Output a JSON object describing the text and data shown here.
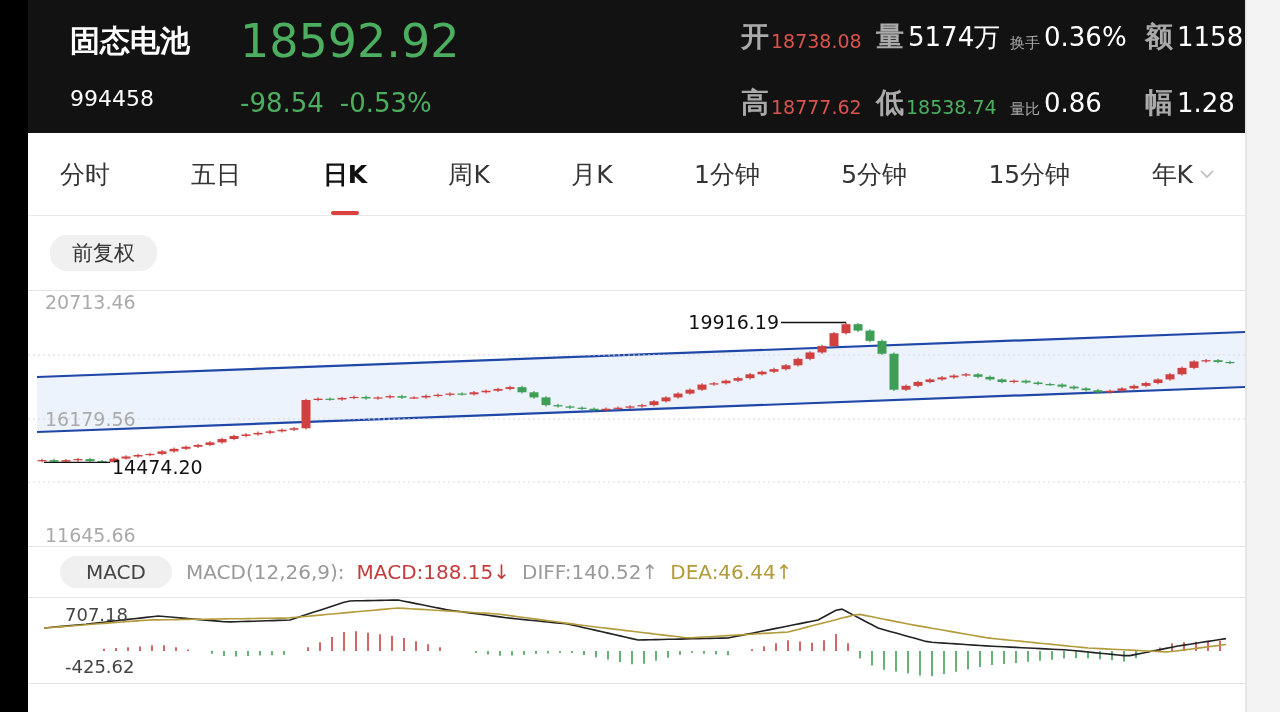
{
  "header": {
    "name": "固态电池",
    "code": "994458",
    "price": "18592.92",
    "change": "-98.54",
    "change_pct": "-0.53%",
    "stats": [
      {
        "label": "开",
        "value": "18738.08",
        "color": "#d9534f",
        "kind": "large"
      },
      {
        "label": "量",
        "value": "5174万",
        "color": "#ffffff",
        "kind": "large"
      },
      {
        "label": "换手",
        "value": "0.36%",
        "color": "#ffffff",
        "kind": "small"
      },
      {
        "label": "额",
        "value": "1158",
        "color": "#ffffff",
        "kind": "large"
      },
      {
        "label": "高",
        "value": "18777.62",
        "color": "#d9534f",
        "kind": "large"
      },
      {
        "label": "低",
        "value": "18538.74",
        "color": "#4caf5f",
        "kind": "large"
      },
      {
        "label": "量比",
        "value": "0.86",
        "color": "#ffffff",
        "kind": "small"
      },
      {
        "label": "幅",
        "value": "1.28",
        "color": "#ffffff",
        "kind": "large"
      }
    ]
  },
  "tabs": [
    {
      "label": "分时",
      "selected": false,
      "dropdown": false
    },
    {
      "label": "五日",
      "selected": false,
      "dropdown": false
    },
    {
      "label": "日K",
      "selected": true,
      "dropdown": false
    },
    {
      "label": "周K",
      "selected": false,
      "dropdown": false
    },
    {
      "label": "月K",
      "selected": false,
      "dropdown": false
    },
    {
      "label": "1分钟",
      "selected": false,
      "dropdown": false
    },
    {
      "label": "5分钟",
      "selected": false,
      "dropdown": false
    },
    {
      "label": "15分钟",
      "selected": false,
      "dropdown": false
    },
    {
      "label": "年K",
      "selected": false,
      "dropdown": true
    }
  ],
  "adjust_button": "前复权",
  "price_chart": {
    "chart_data": {
      "type": "candlestick",
      "ylim": [
        11645.66,
        20713.46
      ],
      "yticks": [
        20713.46,
        16179.56,
        11645.66
      ],
      "annotations": [
        "19916.19",
        "14474.20"
      ],
      "ohlc": [
        [
          14520,
          14610,
          14474.2,
          14560
        ],
        [
          14560,
          14610,
          14480,
          14500
        ],
        [
          14500,
          14600,
          14480,
          14560
        ],
        [
          14560,
          14640,
          14500,
          14600
        ],
        [
          14600,
          14640,
          14480,
          14520
        ],
        [
          14520,
          14560,
          14478,
          14480
        ],
        [
          14480,
          14670,
          14480,
          14620
        ],
        [
          14620,
          14750,
          14570,
          14700
        ],
        [
          14700,
          14810,
          14650,
          14760
        ],
        [
          14760,
          14850,
          14710,
          14800
        ],
        [
          14800,
          14950,
          14750,
          14900
        ],
        [
          14900,
          15050,
          14850,
          15000
        ],
        [
          15000,
          15130,
          14950,
          15080
        ],
        [
          15080,
          15200,
          15030,
          15150
        ],
        [
          15150,
          15300,
          15100,
          15250
        ],
        [
          15250,
          15430,
          15200,
          15380
        ],
        [
          15380,
          15550,
          15330,
          15500
        ],
        [
          15500,
          15610,
          15450,
          15560
        ],
        [
          15560,
          15670,
          15510,
          15620
        ],
        [
          15620,
          15730,
          15570,
          15680
        ],
        [
          15680,
          15790,
          15630,
          15740
        ],
        [
          15740,
          15850,
          15690,
          15800
        ],
        [
          15800,
          16950,
          15750,
          16900
        ],
        [
          16900,
          17000,
          16850,
          16950
        ],
        [
          16950,
          17000,
          16870,
          16920
        ],
        [
          16920,
          17030,
          16870,
          16980
        ],
        [
          16980,
          17070,
          16930,
          17020
        ],
        [
          17020,
          17070,
          16910,
          16960
        ],
        [
          16960,
          17050,
          16910,
          17000
        ],
        [
          17000,
          17100,
          16950,
          17050
        ],
        [
          17050,
          17100,
          16940,
          16990
        ],
        [
          16990,
          17050,
          16940,
          17000
        ],
        [
          17000,
          17110,
          16950,
          17060
        ],
        [
          17060,
          17150,
          17010,
          17100
        ],
        [
          17100,
          17200,
          17050,
          17150
        ],
        [
          17150,
          17200,
          17070,
          17120
        ],
        [
          17120,
          17250,
          17070,
          17200
        ],
        [
          17200,
          17310,
          17150,
          17260
        ],
        [
          17260,
          17380,
          17210,
          17330
        ],
        [
          17330,
          17450,
          17280,
          17400
        ],
        [
          17400,
          17450,
          17150,
          17200
        ],
        [
          17200,
          17250,
          16950,
          17000
        ],
        [
          17000,
          17050,
          16650,
          16700
        ],
        [
          16700,
          16750,
          16600,
          16650
        ],
        [
          16650,
          16700,
          16550,
          16600
        ],
        [
          16600,
          16650,
          16510,
          16560
        ],
        [
          16560,
          16610,
          16450,
          16500
        ],
        [
          16500,
          16610,
          16450,
          16560
        ],
        [
          16560,
          16650,
          16510,
          16600
        ],
        [
          16600,
          16700,
          16550,
          16650
        ],
        [
          16650,
          16750,
          16600,
          16700
        ],
        [
          16700,
          16900,
          16650,
          16850
        ],
        [
          16850,
          17050,
          16800,
          17000
        ],
        [
          17000,
          17200,
          16950,
          17150
        ],
        [
          17150,
          17350,
          17100,
          17300
        ],
        [
          17300,
          17550,
          17250,
          17500
        ],
        [
          17500,
          17600,
          17450,
          17550
        ],
        [
          17550,
          17700,
          17500,
          17650
        ],
        [
          17650,
          17800,
          17600,
          17750
        ],
        [
          17750,
          17950,
          17700,
          17900
        ],
        [
          17900,
          18050,
          17850,
          18000
        ],
        [
          18000,
          18150,
          17950,
          18100
        ],
        [
          18100,
          18300,
          18050,
          18250
        ],
        [
          18250,
          18550,
          18200,
          18500
        ],
        [
          18500,
          18800,
          18450,
          18750
        ],
        [
          18750,
          19050,
          18700,
          19000
        ],
        [
          19000,
          19550,
          18950,
          19500
        ],
        [
          19500,
          19916.19,
          19450,
          19850
        ],
        [
          19850,
          19900,
          19550,
          19600
        ],
        [
          19600,
          19650,
          19150,
          19200
        ],
        [
          19200,
          19250,
          18650,
          18700
        ],
        [
          18700,
          18750,
          17250,
          17300
        ],
        [
          17300,
          17500,
          17250,
          17450
        ],
        [
          17450,
          17650,
          17400,
          17600
        ],
        [
          17600,
          17750,
          17550,
          17700
        ],
        [
          17700,
          17830,
          17650,
          17780
        ],
        [
          17780,
          17900,
          17730,
          17850
        ],
        [
          17850,
          17950,
          17800,
          17900
        ],
        [
          17900,
          17950,
          17750,
          17800
        ],
        [
          17800,
          17850,
          17650,
          17700
        ],
        [
          17700,
          17750,
          17550,
          17600
        ],
        [
          17600,
          17700,
          17550,
          17650
        ],
        [
          17650,
          17700,
          17530,
          17580
        ],
        [
          17580,
          17630,
          17470,
          17520
        ],
        [
          17520,
          17570,
          17450,
          17500
        ],
        [
          17500,
          17550,
          17370,
          17420
        ],
        [
          17420,
          17470,
          17300,
          17350
        ],
        [
          17350,
          17400,
          17230,
          17280
        ],
        [
          17280,
          17330,
          17150,
          17200
        ],
        [
          17200,
          17310,
          17150,
          17260
        ],
        [
          17260,
          17400,
          17210,
          17350
        ],
        [
          17350,
          17500,
          17300,
          17450
        ],
        [
          17450,
          17610,
          17400,
          17560
        ],
        [
          17560,
          17750,
          17510,
          17700
        ],
        [
          17700,
          17950,
          17650,
          17900
        ],
        [
          17900,
          18200,
          17850,
          18150
        ],
        [
          18150,
          18450,
          18100,
          18400
        ],
        [
          18400,
          18500,
          18350,
          18450
        ],
        [
          18450,
          18500,
          18330,
          18380
        ],
        [
          18380,
          18430,
          18300,
          18350
        ]
      ]
    }
  },
  "macd": {
    "button": "MACD",
    "params": "MACD(12,26,9):",
    "values": [
      {
        "text": "MACD:188.15↓",
        "color": "#c43c3c"
      },
      {
        "text": "DIFF:140.52↑",
        "color": "#9a9a9a"
      },
      {
        "text": "DEA:46.44↑",
        "color": "#b39a3a"
      }
    ],
    "y_labels": [
      "707.18",
      "-425.62"
    ]
  }
}
